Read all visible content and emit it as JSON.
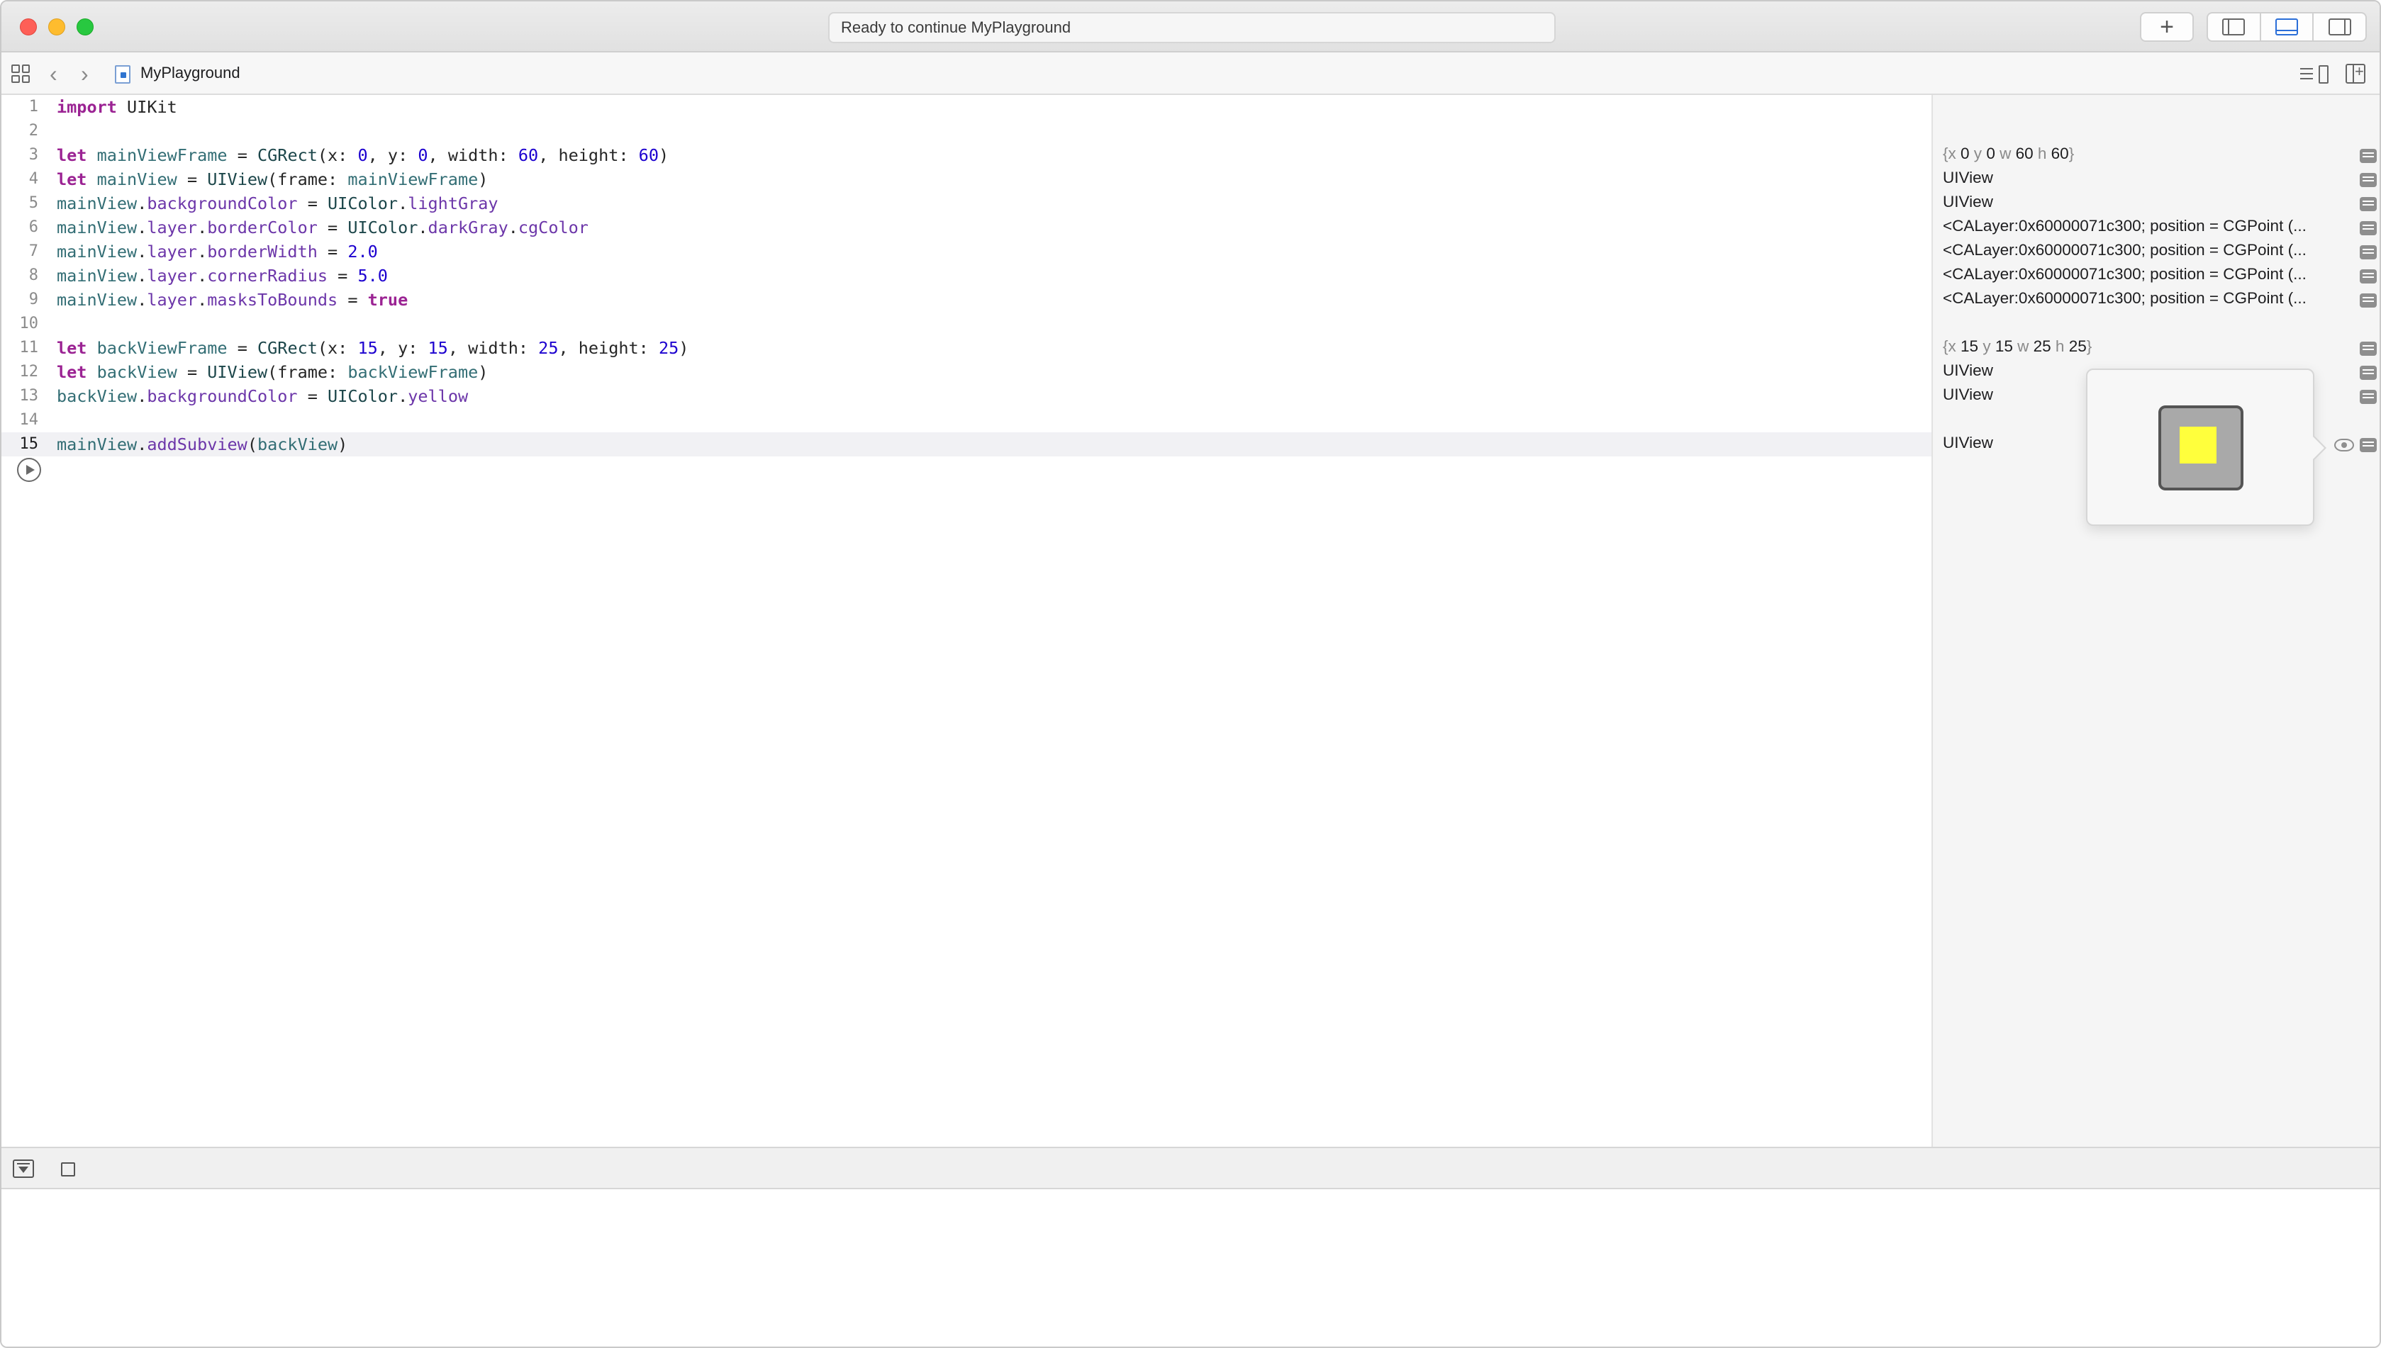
{
  "window": {
    "activity_status": "Ready to continue MyPlayground"
  },
  "toolbar": {
    "add_label": "+"
  },
  "jumpbar": {
    "back": "‹",
    "forward": "›",
    "file_name": "MyPlayground"
  },
  "editor": {
    "lines": [
      {
        "n": "1"
      },
      {
        "n": "2"
      },
      {
        "n": "3"
      },
      {
        "n": "4"
      },
      {
        "n": "5"
      },
      {
        "n": "6"
      },
      {
        "n": "7"
      },
      {
        "n": "8"
      },
      {
        "n": "9"
      },
      {
        "n": "10"
      },
      {
        "n": "11"
      },
      {
        "n": "12"
      },
      {
        "n": "13"
      },
      {
        "n": "14"
      },
      {
        "n": "15"
      }
    ],
    "tokens": {
      "import": "import",
      "uikit": "UIKit",
      "let": "let",
      "mainViewFrame": "mainViewFrame",
      "mainView": "mainView",
      "backViewFrame": "backViewFrame",
      "backView": "backView",
      "CGRect": "CGRect",
      "UIView": "UIView",
      "UIColor": "UIColor",
      "backgroundColor": "backgroundColor",
      "layer": "layer",
      "borderColor": "borderColor",
      "borderWidth": "borderWidth",
      "cornerRadius": "cornerRadius",
      "masksToBounds": "masksToBounds",
      "lightGray": "lightGray",
      "darkGray": "darkGray",
      "cgColor": "cgColor",
      "yellow": "yellow",
      "addSubview": "addSubview",
      "true": "true",
      "n0": "0",
      "n60": "60",
      "n15": "15",
      "n25": "25",
      "n2": "2.0",
      "n5": "5.0"
    }
  },
  "results": {
    "rows": [
      {
        "x": "0",
        "y": "0",
        "w": "60",
        "h": "60"
      },
      "UIView",
      "UIView",
      "<CALayer:0x60000071c300; position = CGPoint (...",
      "<CALayer:0x60000071c300; position = CGPoint (...",
      "<CALayer:0x60000071c300; position = CGPoint (...",
      "<CALayer:0x60000071c300; position = CGPoint (...",
      {
        "x": "15",
        "y": "15",
        "w": "25",
        "h": "25"
      },
      "UIView",
      "UIView",
      "UIView"
    ]
  },
  "preview": {
    "main_color": "#a9a9a9",
    "border_color": "#545454",
    "sub_color": "#ffff3c"
  }
}
